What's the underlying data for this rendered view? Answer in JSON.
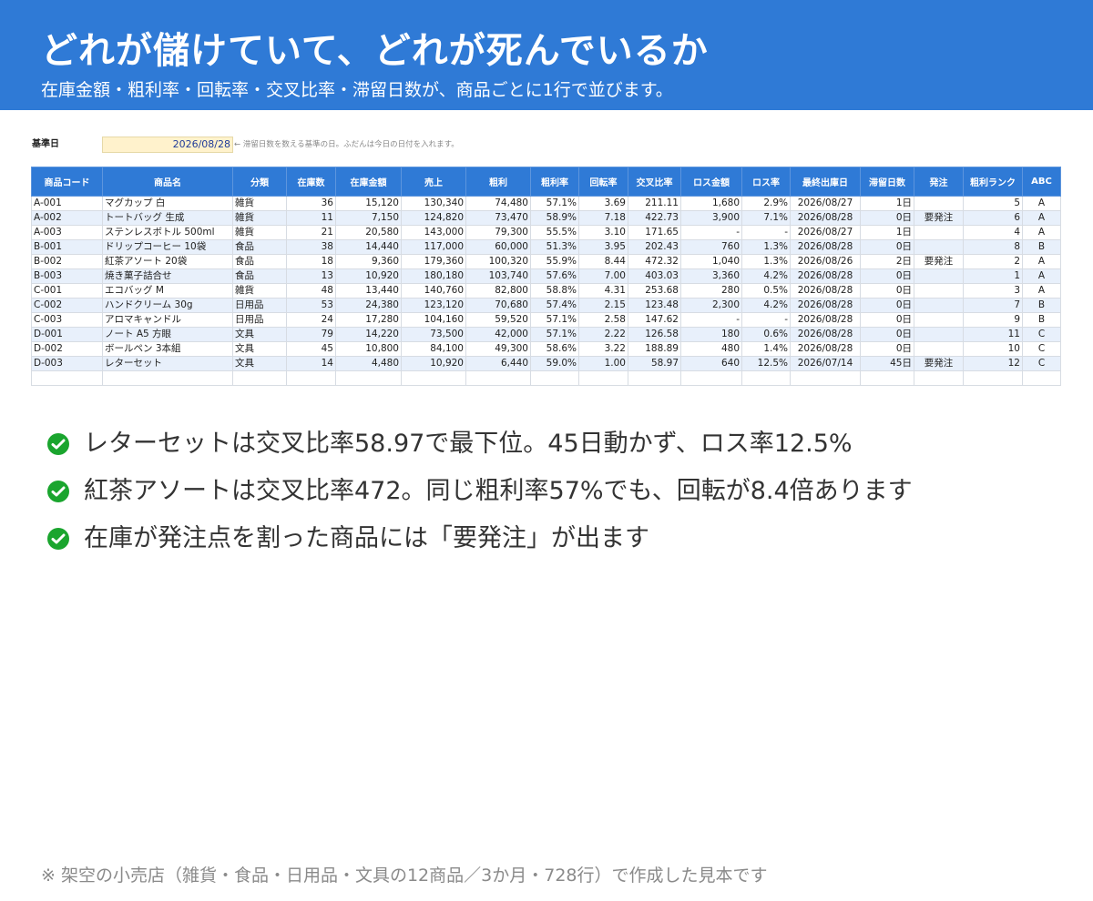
{
  "header": {
    "title": "どれが儲けていて、どれが死んでいるか",
    "subtitle": "在庫金額・粗利率・回転率・交叉比率・滞留日数が、商品ごとに1行で並びます。"
  },
  "base_date": {
    "label": "基準日",
    "value": "2026/08/28",
    "note": "← 滞留日数を数える基準の日。ふだんは今日の日付を入れます。"
  },
  "table": {
    "columns": [
      "商品コード",
      "商品名",
      "分類",
      "在庫数",
      "在庫金額",
      "売上",
      "粗利",
      "粗利率",
      "回転率",
      "交叉比率",
      "ロス金額",
      "ロス率",
      "最終出庫日",
      "滞留日数",
      "発注",
      "粗利ランク",
      "ABC"
    ],
    "rows": [
      [
        "A-001",
        "マグカップ 白",
        "雑貨",
        "36",
        "15,120",
        "130,340",
        "74,480",
        "57.1%",
        "3.69",
        "211.11",
        "1,680",
        "2.9%",
        "2026/08/27",
        "1日",
        "",
        "5",
        "A"
      ],
      [
        "A-002",
        "トートバッグ 生成",
        "雑貨",
        "11",
        "7,150",
        "124,820",
        "73,470",
        "58.9%",
        "7.18",
        "422.73",
        "3,900",
        "7.1%",
        "2026/08/28",
        "0日",
        "要発注",
        "6",
        "A"
      ],
      [
        "A-003",
        "ステンレスボトル 500ml",
        "雑貨",
        "21",
        "20,580",
        "143,000",
        "79,300",
        "55.5%",
        "3.10",
        "171.65",
        "-",
        "-",
        "2026/08/27",
        "1日",
        "",
        "4",
        "A"
      ],
      [
        "B-001",
        "ドリップコーヒー 10袋",
        "食品",
        "38",
        "14,440",
        "117,000",
        "60,000",
        "51.3%",
        "3.95",
        "202.43",
        "760",
        "1.3%",
        "2026/08/28",
        "0日",
        "",
        "8",
        "B"
      ],
      [
        "B-002",
        "紅茶アソート 20袋",
        "食品",
        "18",
        "9,360",
        "179,360",
        "100,320",
        "55.9%",
        "8.44",
        "472.32",
        "1,040",
        "1.3%",
        "2026/08/26",
        "2日",
        "要発注",
        "2",
        "A"
      ],
      [
        "B-003",
        "焼き菓子詰合せ",
        "食品",
        "13",
        "10,920",
        "180,180",
        "103,740",
        "57.6%",
        "7.00",
        "403.03",
        "3,360",
        "4.2%",
        "2026/08/28",
        "0日",
        "",
        "1",
        "A"
      ],
      [
        "C-001",
        "エコバッグ M",
        "雑貨",
        "48",
        "13,440",
        "140,760",
        "82,800",
        "58.8%",
        "4.31",
        "253.68",
        "280",
        "0.5%",
        "2026/08/28",
        "0日",
        "",
        "3",
        "A"
      ],
      [
        "C-002",
        "ハンドクリーム 30g",
        "日用品",
        "53",
        "24,380",
        "123,120",
        "70,680",
        "57.4%",
        "2.15",
        "123.48",
        "2,300",
        "4.2%",
        "2026/08/28",
        "0日",
        "",
        "7",
        "B"
      ],
      [
        "C-003",
        "アロマキャンドル",
        "日用品",
        "24",
        "17,280",
        "104,160",
        "59,520",
        "57.1%",
        "2.58",
        "147.62",
        "-",
        "-",
        "2026/08/28",
        "0日",
        "",
        "9",
        "B"
      ],
      [
        "D-001",
        "ノート A5 方眼",
        "文具",
        "79",
        "14,220",
        "73,500",
        "42,000",
        "57.1%",
        "2.22",
        "126.58",
        "180",
        "0.6%",
        "2026/08/28",
        "0日",
        "",
        "11",
        "C"
      ],
      [
        "D-002",
        "ボールペン 3本組",
        "文具",
        "45",
        "10,800",
        "84,100",
        "49,300",
        "58.6%",
        "3.22",
        "188.89",
        "480",
        "1.4%",
        "2026/08/28",
        "0日",
        "",
        "10",
        "C"
      ],
      [
        "D-003",
        "レターセット",
        "文具",
        "14",
        "4,480",
        "10,920",
        "6,440",
        "59.0%",
        "1.00",
        "58.97",
        "640",
        "12.5%",
        "2026/07/14",
        "45日",
        "要発注",
        "12",
        "C"
      ]
    ]
  },
  "bullets": [
    "レターセットは交叉比率58.97で最下位。45日動かず、ロス率12.5%",
    "紅茶アソートは交叉比率472。同じ粗利率57%でも、回転が8.4倍あります",
    "在庫が発注点を割った商品には「要発注」が出ます"
  ],
  "footnote": "※ 架空の小売店（雑貨・食品・日用品・文具の12商品／3か月・728行）で作成した見本です",
  "colors": {
    "accent": "#2f7ad6",
    "check": "#1aa52e",
    "highlight": "#fff2cc",
    "row_alt": "#e8f0fb"
  },
  "icons": {
    "bullet": "check-circle-icon"
  }
}
